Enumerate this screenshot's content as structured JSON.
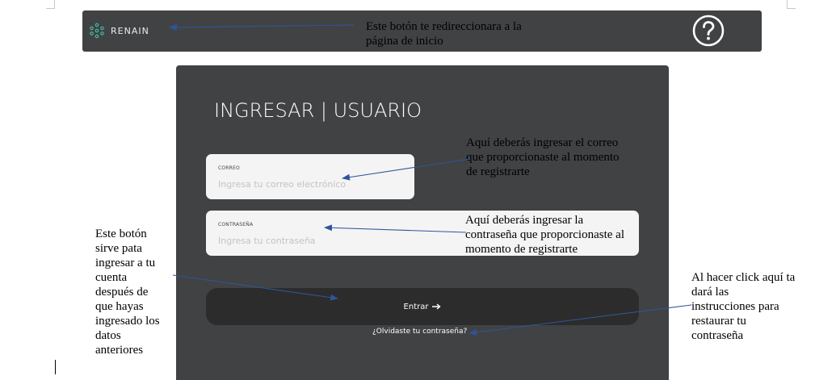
{
  "navbar": {
    "brand_name": "RENAIN",
    "brand_icon": "network-nodes-icon",
    "help_icon": "question-mark-circle-icon",
    "background_color": "#414244"
  },
  "login": {
    "title": "INGRESAR | USUARIO",
    "email": {
      "label": "CORREO",
      "placeholder": "Ingresa tu correo electrónico",
      "value": ""
    },
    "password": {
      "label": "CONTRASEÑA",
      "placeholder": "Ingresa tu contraseña",
      "value": ""
    },
    "submit_label": "Entrar",
    "submit_icon": "arrow-right-icon",
    "forgot_label": "¿Olvidaste tu contraseña?",
    "card_color": "#414244",
    "button_color": "#2c2c2c"
  },
  "annotations": {
    "home_note": "Este botón te redireccionara a la\npágina de inicio",
    "email_note": "Aquí deberás ingresar el correo\nque proporcionaste al momento\nde registrarte",
    "password_note": "Aquí deberás ingresar la\ncontraseña que proporcionaste al\nmomento de registrarte",
    "submit_note": "Este botón\nsirve pata\ningresar a tu\ncuenta\ndespués de\nque hayas\ningresado los\ndatos\nanteriores",
    "forgot_note": "Al hacer click aquí ta\ndará las\ninstrucciones para\nrestaurar tu\ncontraseña",
    "arrow_color": "#2e5597"
  }
}
